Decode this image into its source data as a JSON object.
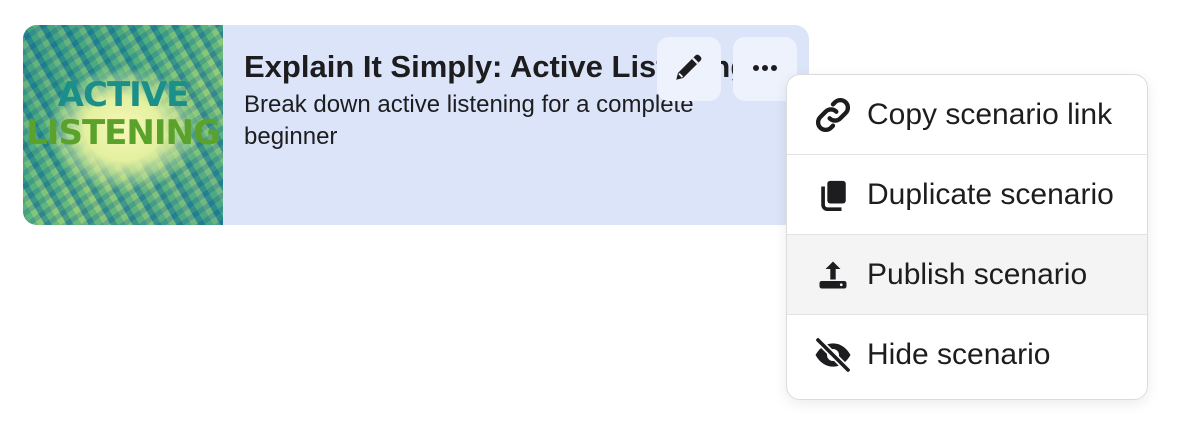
{
  "card": {
    "thumbnail": {
      "line1": "ACTIVE",
      "line2": "LISTENING",
      "icon": "active-listening-artwork"
    },
    "title": "Explain It Simply: Active Listening",
    "description": "Break down active listening for a complete beginner",
    "edit_icon": "pencil-icon",
    "more_icon": "ellipsis-icon"
  },
  "menu": {
    "items": [
      {
        "label": "Copy scenario link",
        "icon": "link-icon"
      },
      {
        "label": "Duplicate scenario",
        "icon": "copy-icon"
      },
      {
        "label": "Publish scenario",
        "icon": "upload-icon"
      },
      {
        "label": "Hide scenario",
        "icon": "eye-slash-icon"
      }
    ]
  },
  "colors": {
    "card_background": "#dbe4f8",
    "button_background": "#eef2fc",
    "menu_hover": "#f4f4f4",
    "text": "#1d1d1f"
  }
}
